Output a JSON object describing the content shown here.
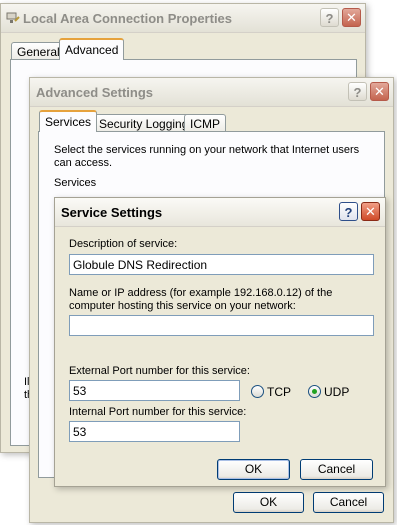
{
  "lac": {
    "title": "Local Area Connection Properties",
    "tabs": [
      "General",
      "Advanced"
    ],
    "partial_text": "Il\nth",
    "help": "?",
    "close": "✕"
  },
  "adv": {
    "title": "Advanced Settings",
    "tabs": [
      "Services",
      "Security Logging",
      "ICMP"
    ],
    "instructions": "Select the services running on your network that Internet users can access.",
    "services_label": "Services",
    "ok": "OK",
    "cancel": "Cancel",
    "help": "?",
    "close": "✕"
  },
  "svc": {
    "title": "Service Settings",
    "help": "?",
    "close": "✕",
    "desc_label": "Description of service:",
    "desc_value": "Globule DNS Redirection",
    "ip_label": "Name or IP address (for example 192.168.0.12) of the computer hosting this service on your network:",
    "ip_value": "",
    "ext_label": "External Port number for this service:",
    "ext_value": "53",
    "int_label": "Internal Port number for this service:",
    "int_value": "53",
    "protocols": {
      "tcp": "TCP",
      "udp": "UDP",
      "selected": "UDP"
    },
    "ok": "OK",
    "cancel": "Cancel"
  }
}
